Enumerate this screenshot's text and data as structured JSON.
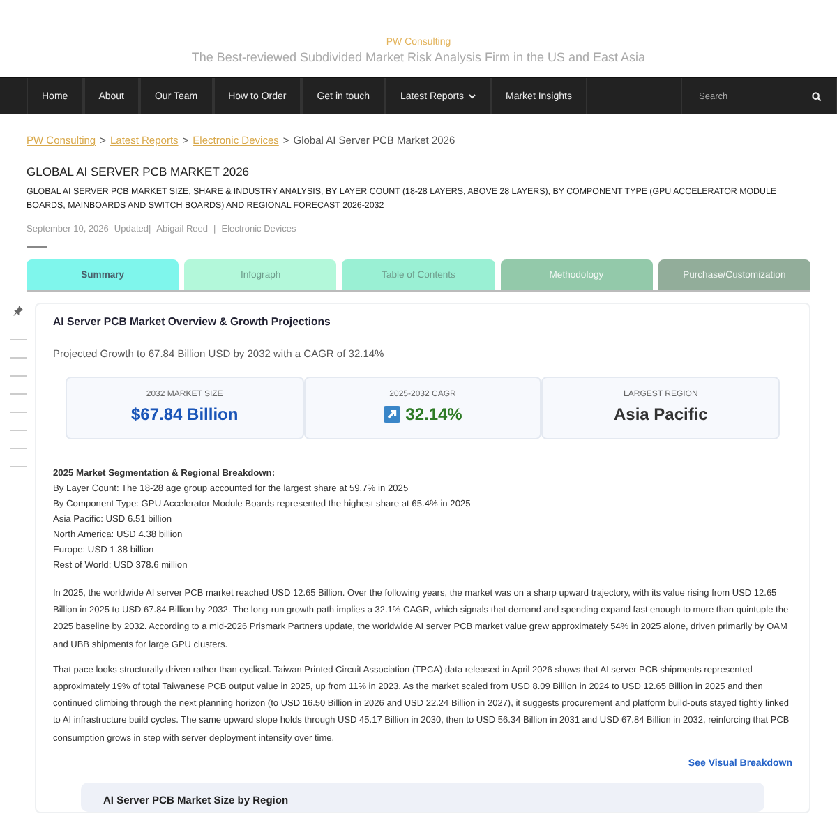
{
  "header": {
    "brand": "PW Consulting",
    "tagline": "The Best-reviewed Subdivided Market Risk Analysis Firm in the US and East Asia"
  },
  "nav": {
    "items": [
      {
        "label": "Home",
        "has_menu": false
      },
      {
        "label": "About",
        "has_menu": false
      },
      {
        "label": "Our Team",
        "has_menu": false
      },
      {
        "label": "How to Order",
        "has_menu": false
      },
      {
        "label": "Get in touch",
        "has_menu": false
      },
      {
        "label": "Latest Reports",
        "has_menu": true
      },
      {
        "label": "Market Insights",
        "has_menu": false
      }
    ],
    "search": {
      "placeholder": "Search"
    }
  },
  "breadcrumb": {
    "separator": ">",
    "links": [
      "PW Consulting",
      "Latest Reports",
      "Electronic Devices"
    ],
    "current": "Global AI Server PCB Market 2026"
  },
  "title": "GLOBAL AI SERVER PCB MARKET 2026",
  "subtitle": "GLOBAL AI SERVER PCB MARKET SIZE, SHARE & INDUSTRY ANALYSIS, BY LAYER COUNT (18-28 LAYERS, ABOVE 28 LAYERS), BY COMPONENT TYPE (GPU ACCELERATOR MODULE BOARDS, MAINBOARDS AND SWITCH BOARDS) AND REGIONAL FORECAST 2026-2032",
  "meta": {
    "date": "September 10, 2026",
    "updated": "Updated|",
    "author": "Abigail Reed",
    "separator": "|",
    "category": "Electronic Devices"
  },
  "tabs": [
    {
      "label": "Summary",
      "selected": true,
      "disabled": false,
      "color": "#7ff6ec"
    },
    {
      "label": "Infograph",
      "selected": false,
      "disabled": true,
      "color": "#b3f8da"
    },
    {
      "label": "Table of Contents",
      "selected": false,
      "disabled": true,
      "color": "#9af0d4"
    },
    {
      "label": "Methodology",
      "selected": false,
      "disabled": false,
      "color": "#93c9aa"
    },
    {
      "label": "Purchase/Customization",
      "selected": false,
      "disabled": false,
      "color": "#92ad9a"
    }
  ],
  "card": {
    "title": "AI Server PCB Market Overview & Growth Projections",
    "lead": "Projected Growth to 67.84 Billion USD by 2032 with a CAGR of 32.14%",
    "stats": [
      {
        "kind": "money",
        "label": "2032 MARKET SIZE",
        "value": "$67.84 Billion"
      },
      {
        "kind": "growth",
        "label": "2025-2032 CAGR",
        "value": "32.14%"
      },
      {
        "kind": "plain",
        "label": "LARGEST REGION",
        "value": "Asia Pacific"
      }
    ],
    "segmentation": {
      "heading": "2025 Market Segmentation & Regional Breakdown:",
      "lines": [
        "By Layer Count: The 18-28 age group accounted for the largest share at 59.7% in 2025",
        "By Component Type: GPU Accelerator Module Boards represented the highest share at 65.4% in 2025",
        "Asia Pacific: USD 6.51 billion",
        "North America: USD 4.38 billion",
        "Europe: USD 1.38 billion",
        "Rest of World: USD 378.6 million"
      ]
    },
    "paragraphs": [
      "In 2025, the worldwide AI server PCB market reached USD 12.65 Billion. Over the following years, the market was on a sharp upward trajectory, with its value rising from USD 12.65 Billion in 2025 to USD 67.84 Billion by 2032. The long-run growth path implies a 32.1% CAGR, which signals that demand and spending expand fast enough to more than quintuple the 2025 baseline by 2032. According to a mid-2026 Prismark Partners update, the worldwide AI server PCB market value grew approximately 54% in 2025 alone, driven primarily by OAM and UBB shipments for large GPU clusters.",
      "That pace looks structurally driven rather than cyclical. Taiwan Printed Circuit Association (TPCA) data released in April 2026 shows that AI server PCB shipments represented approximately 19% of total Taiwanese PCB output value in 2025, up from 11% in 2023. As the market scaled from USD 8.09 Billion in 2024 to USD 12.65 Billion in 2025 and then continued climbing through the next planning horizon (to USD 16.50 Billion in 2026 and USD 22.24 Billion in 2027), it suggests procurement and platform build-outs stayed tightly linked to AI infrastructure build cycles. The same upward slope holds through USD 45.17 Billion in 2030, then to USD 56.34 Billion in 2031 and USD 67.84 Billion in 2032, reinforcing that PCB consumption grows in step with server deployment intensity over time."
    ],
    "link": "See Visual Breakdown",
    "panel_title": "AI Server PCB Market Size by Region"
  }
}
